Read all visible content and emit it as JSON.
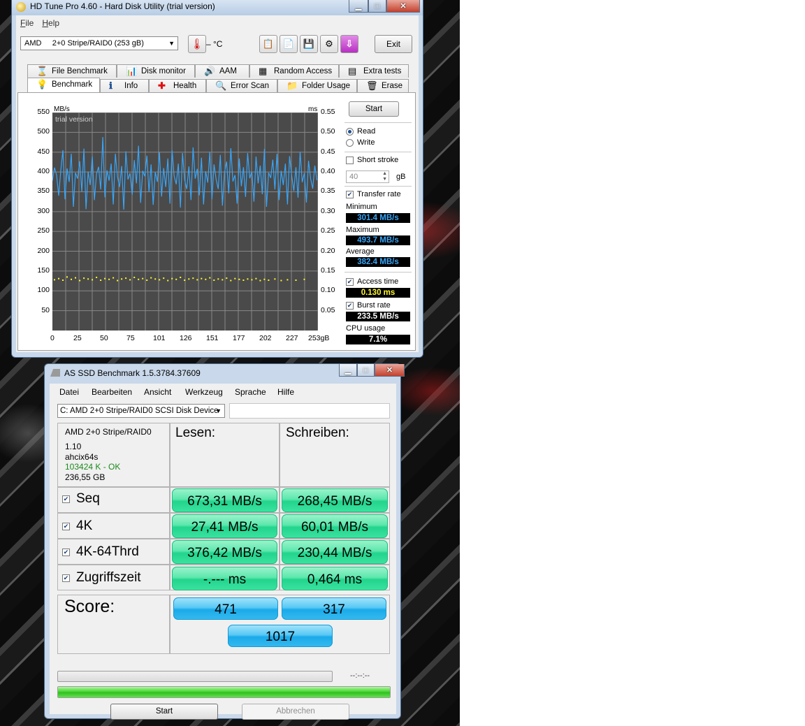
{
  "hdtune": {
    "title": "HD Tune Pro 4.60 - Hard Disk Utility (trial version)",
    "menu": [
      "File",
      "Help"
    ],
    "drive": "AMD     2+0 Stripe/RAID0 (253 gB)",
    "temperature": "– °C",
    "exit_label": "Exit",
    "tabs_row1": [
      "File Benchmark",
      "Disk monitor",
      "AAM",
      "Random Access",
      "Extra tests"
    ],
    "tabs_row2": [
      "Benchmark",
      "Info",
      "Health",
      "Error Scan",
      "Folder Usage",
      "Erase"
    ],
    "active_tab": "Benchmark",
    "start_label": "Start",
    "read_label": "Read",
    "write_label": "Write",
    "short_stroke_label": "Short stroke",
    "short_stroke_value": "40",
    "gb_unit": "gB",
    "transfer_rate_label": "Transfer rate",
    "minimum_label": "Minimum",
    "minimum_value": "301.4 MB/s",
    "maximum_label": "Maximum",
    "maximum_value": "493.7 MB/s",
    "average_label": "Average",
    "average_value": "382.4 MB/s",
    "access_time_label": "Access time",
    "access_time_value": "0.130 ms",
    "burst_rate_label": "Burst rate",
    "burst_rate_value": "233.5 MB/s",
    "cpu_usage_label": "CPU usage",
    "cpu_usage_value": "7.1%",
    "colors": {
      "transfer": "#39a5f7",
      "access": "#fff82a",
      "grid": "#888888",
      "plot_bg": "#4a4a4a"
    }
  },
  "chart_data": {
    "type": "line",
    "watermark": "trial version",
    "y_unit_left": "MB/s",
    "y_unit_right": "ms",
    "y_ticks_left": [
      "550",
      "500",
      "450",
      "400",
      "350",
      "300",
      "250",
      "200",
      "150",
      "100",
      "50"
    ],
    "y_ticks_right": [
      "0.55",
      "0.50",
      "0.45",
      "0.40",
      "0.35",
      "0.30",
      "0.25",
      "0.20",
      "0.15",
      "0.10",
      "0.05"
    ],
    "x_ticks": [
      "0",
      "25",
      "50",
      "75",
      "101",
      "126",
      "151",
      "177",
      "202",
      "227",
      "253gB"
    ],
    "xlim": [
      0,
      253
    ],
    "ylim": [
      0,
      550
    ],
    "ylim_right": [
      0,
      0.55
    ],
    "grid": true,
    "series": [
      {
        "name": "Transfer rate",
        "points": [
          [
            0,
            378
          ],
          [
            2,
            411
          ],
          [
            4,
            392
          ],
          [
            6,
            340
          ],
          [
            8,
            404
          ],
          [
            10,
            455
          ],
          [
            12,
            331
          ],
          [
            14,
            409
          ],
          [
            16,
            375
          ],
          [
            18,
            446
          ],
          [
            20,
            312
          ],
          [
            22,
            398
          ],
          [
            24,
            383
          ],
          [
            26,
            427
          ],
          [
            28,
            350
          ],
          [
            30,
            459
          ],
          [
            32,
            306
          ],
          [
            34,
            401
          ],
          [
            36,
            367
          ],
          [
            38,
            440
          ],
          [
            40,
            329
          ],
          [
            42,
            395
          ],
          [
            44,
            413
          ],
          [
            46,
            356
          ],
          [
            48,
            488
          ],
          [
            50,
            336
          ],
          [
            52,
            404
          ],
          [
            54,
            378
          ],
          [
            56,
            421
          ],
          [
            58,
            318
          ],
          [
            60,
            446
          ],
          [
            62,
            388
          ],
          [
            64,
            362
          ],
          [
            66,
            415
          ],
          [
            68,
            305
          ],
          [
            70,
            452
          ],
          [
            72,
            381
          ],
          [
            74,
            397
          ],
          [
            76,
            342
          ],
          [
            78,
            430
          ],
          [
            80,
            371
          ],
          [
            82,
            466
          ],
          [
            84,
            322
          ],
          [
            86,
            403
          ],
          [
            88,
            389
          ],
          [
            90,
            441
          ],
          [
            92,
            349
          ],
          [
            94,
            419
          ],
          [
            96,
            317
          ],
          [
            98,
            400
          ],
          [
            100,
            375
          ],
          [
            102,
            450
          ],
          [
            104,
            338
          ],
          [
            106,
            410
          ],
          [
            108,
            362
          ],
          [
            110,
            434
          ],
          [
            112,
            320
          ],
          [
            114,
            455
          ],
          [
            116,
            390
          ],
          [
            118,
            369
          ],
          [
            120,
            421
          ],
          [
            122,
            310
          ],
          [
            124,
            448
          ],
          [
            126,
            380
          ],
          [
            128,
            357
          ],
          [
            130,
            414
          ],
          [
            132,
            329
          ],
          [
            134,
            462
          ],
          [
            136,
            383
          ],
          [
            138,
            408
          ],
          [
            140,
            341
          ],
          [
            142,
            436
          ],
          [
            144,
            318
          ],
          [
            146,
            402
          ],
          [
            148,
            373
          ],
          [
            150,
            451
          ],
          [
            152,
            331
          ],
          [
            154,
            419
          ],
          [
            156,
            381
          ],
          [
            158,
            357
          ],
          [
            160,
            443
          ],
          [
            162,
            315
          ],
          [
            164,
            399
          ],
          [
            166,
            426
          ],
          [
            168,
            346
          ],
          [
            170,
            460
          ],
          [
            172,
            376
          ],
          [
            174,
            392
          ],
          [
            176,
            320
          ],
          [
            178,
            434
          ],
          [
            180,
            364
          ],
          [
            182,
            412
          ],
          [
            184,
            337
          ],
          [
            186,
            448
          ],
          [
            188,
            384
          ],
          [
            190,
            401
          ],
          [
            192,
            325
          ],
          [
            194,
            439
          ],
          [
            196,
            371
          ],
          [
            198,
            416
          ],
          [
            200,
            344
          ],
          [
            202,
            458
          ],
          [
            204,
            312
          ],
          [
            206,
            398
          ],
          [
            208,
            385
          ],
          [
            210,
            431
          ],
          [
            212,
            356
          ],
          [
            214,
            446
          ],
          [
            216,
            329
          ],
          [
            218,
            403
          ],
          [
            220,
            367
          ],
          [
            222,
            421
          ],
          [
            224,
            318
          ],
          [
            226,
            440
          ],
          [
            228,
            390
          ],
          [
            230,
            352
          ],
          [
            232,
            412
          ],
          [
            234,
            335
          ],
          [
            236,
            451
          ],
          [
            238,
            374
          ],
          [
            240,
            397
          ],
          [
            242,
            323
          ],
          [
            244,
            428
          ],
          [
            246,
            383
          ],
          [
            248,
            358
          ],
          [
            250,
            416
          ],
          [
            252,
            379
          ]
        ]
      },
      {
        "name": "Access time",
        "unit": "ms",
        "points": [
          [
            2,
            0.128
          ],
          [
            6,
            0.131
          ],
          [
            10,
            0.127
          ],
          [
            14,
            0.135
          ],
          [
            18,
            0.129
          ],
          [
            22,
            0.133
          ],
          [
            26,
            0.126
          ],
          [
            30,
            0.132
          ],
          [
            34,
            0.13
          ],
          [
            38,
            0.128
          ],
          [
            42,
            0.134
          ],
          [
            46,
            0.127
          ],
          [
            50,
            0.131
          ],
          [
            54,
            0.129
          ],
          [
            58,
            0.133
          ],
          [
            62,
            0.126
          ],
          [
            66,
            0.13
          ],
          [
            70,
            0.132
          ],
          [
            74,
            0.128
          ],
          [
            78,
            0.134
          ],
          [
            82,
            0.129
          ],
          [
            86,
            0.131
          ],
          [
            90,
            0.127
          ],
          [
            94,
            0.133
          ],
          [
            98,
            0.13
          ],
          [
            102,
            0.128
          ],
          [
            106,
            0.132
          ],
          [
            110,
            0.126
          ],
          [
            114,
            0.131
          ],
          [
            118,
            0.129
          ],
          [
            122,
            0.134
          ],
          [
            126,
            0.127
          ],
          [
            130,
            0.13
          ],
          [
            134,
            0.132
          ],
          [
            138,
            0.128
          ],
          [
            142,
            0.131
          ],
          [
            146,
            0.129
          ],
          [
            150,
            0.133
          ],
          [
            154,
            0.127
          ],
          [
            158,
            0.13
          ],
          [
            162,
            0.128
          ],
          [
            166,
            0.132
          ],
          [
            170,
            0.126
          ],
          [
            174,
            0.131
          ],
          [
            178,
            0.129
          ],
          [
            182,
            0.127
          ],
          [
            186,
            0.13
          ],
          [
            190,
            0.128
          ],
          [
            194,
            0.131
          ],
          [
            198,
            0.126
          ],
          [
            202,
            0.129
          ],
          [
            206,
            0.127
          ],
          [
            212,
            0.13
          ],
          [
            218,
            0.126
          ],
          [
            224,
            0.128
          ],
          [
            232,
            0.127
          ],
          [
            240,
            0.129
          ]
        ]
      }
    ]
  },
  "asssd": {
    "title": "AS SSD Benchmark 1.5.3784.37609",
    "menu": [
      "Datei",
      "Bearbeiten",
      "Ansicht",
      "Werkzeug",
      "Sprache",
      "Hilfe"
    ],
    "drive": "C: AMD 2+0 Stripe/RAID0 SCSI Disk Device",
    "info": {
      "model": "AMD 2+0 Stripe/RAID0",
      "version": "1.10",
      "driver": "ahcix64s",
      "alignment": "103424 K - OK",
      "size": "236,55 GB"
    },
    "read_header": "Lesen:",
    "write_header": "Schreiben:",
    "rows": [
      {
        "label": "Seq",
        "read": "673,31 MB/s",
        "write": "268,45 MB/s"
      },
      {
        "label": "4K",
        "read": "27,41 MB/s",
        "write": "60,01 MB/s"
      },
      {
        "label": "4K-64Thrd",
        "read": "376,42 MB/s",
        "write": "230,44 MB/s"
      },
      {
        "label": "Zugriffszeit",
        "read": "-.--- ms",
        "write": "0,464 ms"
      }
    ],
    "score_label": "Score:",
    "score_read": "471",
    "score_write": "317",
    "score_total": "1017",
    "timer": "--:--:--",
    "progress_main": 1.0,
    "start_label": "Start",
    "abort_label": "Abbrechen"
  }
}
